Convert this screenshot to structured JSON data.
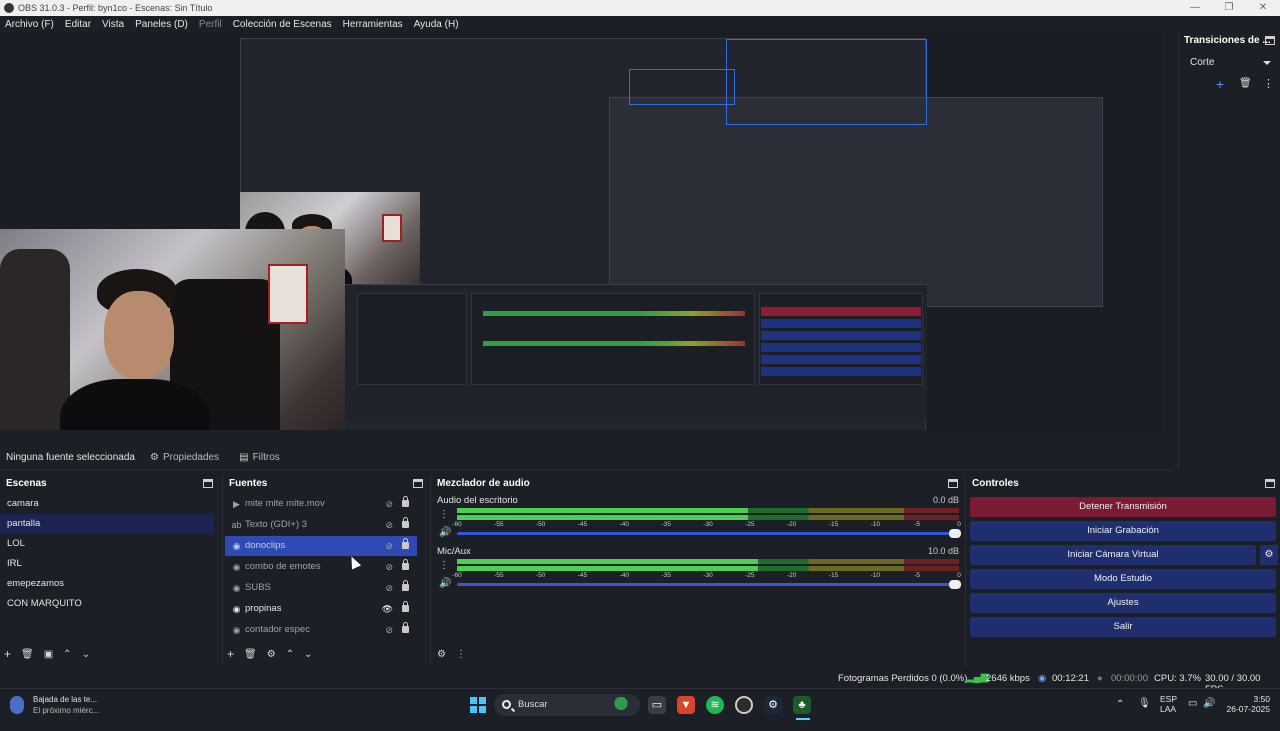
{
  "window": {
    "title": "OBS 31.0.3 - Perfil: byn1co - Escenas: Sin Título",
    "controls": [
      "—",
      "❐",
      "✕"
    ]
  },
  "menu": [
    {
      "label": "Archivo (F)",
      "dim": false
    },
    {
      "label": "Editar",
      "dim": false
    },
    {
      "label": "Vista",
      "dim": false
    },
    {
      "label": "Paneles (D)",
      "dim": false
    },
    {
      "label": "Perfil",
      "dim": true
    },
    {
      "label": "Colección de Escenas",
      "dim": false
    },
    {
      "label": "Herramientas",
      "dim": false
    },
    {
      "label": "Ayuda (H)",
      "dim": false
    }
  ],
  "transitions": {
    "title": "Transiciones de ...",
    "selected": "Corte"
  },
  "properties_bar": {
    "no_source": "Ninguna fuente seleccionada",
    "properties": "Propiedades",
    "filters": "Filtros"
  },
  "scenes": {
    "title": "Escenas",
    "items": [
      {
        "label": "camara",
        "active": false
      },
      {
        "label": "pantalla",
        "active": true
      },
      {
        "label": "LOL",
        "active": false
      },
      {
        "label": "IRL",
        "active": false
      },
      {
        "label": "emepezamos",
        "active": false
      },
      {
        "label": "CON MARQUITO",
        "active": false
      }
    ]
  },
  "sources": {
    "title": "Fuentes",
    "items": [
      {
        "label": "mite mite mite.mov",
        "icon": "play-icon",
        "visible": false,
        "active": false
      },
      {
        "label": "Texto (GDI+) 3",
        "icon": "text-icon",
        "visible": false,
        "active": false
      },
      {
        "label": "donoclips",
        "icon": "globe-icon",
        "visible": false,
        "active": true
      },
      {
        "label": "combo de emotes",
        "icon": "globe-icon",
        "visible": false,
        "active": false
      },
      {
        "label": "SUBS",
        "icon": "globe-icon",
        "visible": false,
        "active": false
      },
      {
        "label": "propinas",
        "icon": "globe-icon",
        "visible": true,
        "active": false
      },
      {
        "label": "contador espec",
        "icon": "globe-icon",
        "visible": false,
        "active": false
      }
    ]
  },
  "mixer": {
    "title": "Mezclador de audio",
    "channels": [
      {
        "name": "Audio del escritorio",
        "db": "0.0 dB",
        "level": 0.58,
        "peak": 0.57
      },
      {
        "name": "Mic/Aux",
        "db": "10.0 dB",
        "level": 0.6,
        "peak": 0.83
      }
    ],
    "ticks": [
      "-60",
      "-55",
      "-50",
      "-45",
      "-40",
      "-35",
      "-30",
      "-25",
      "-20",
      "-15",
      "-10",
      "-5",
      "0"
    ]
  },
  "controls": {
    "title": "Controles",
    "stop_stream": "Detener Transmisión",
    "start_recording": "Iniciar Grabación",
    "virtual_camera": "Iniciar Cámara Virtual",
    "studio_mode": "Modo Estudio",
    "settings": "Ajustes",
    "exit": "Salir"
  },
  "status": {
    "dropped": "Fotogramas Perdidos 0 (0.0%)",
    "bitrate": "2646 kbps",
    "stream_time": "00:12:21",
    "rec_time": "00:00:00",
    "cpu": "CPU: 3.7%",
    "fps": "30.00 / 30.00 FPS"
  },
  "taskbar": {
    "notification_title": "Bajada de las te...",
    "notification_body": "El próximo miérc...",
    "search_placeholder": "Buscar",
    "lang_top": "ESP",
    "lang_bottom": "LAA",
    "time": "3:50",
    "date": "26-07-2025"
  },
  "colors": {
    "stop_button": "#7a1a33",
    "blue_button": "#1f2e6e",
    "selection": "#2f4ab3",
    "meter_green": "#49d14f"
  }
}
